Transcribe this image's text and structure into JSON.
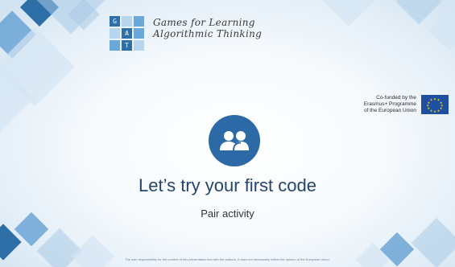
{
  "logo": {
    "title_line1": "Games for Learning",
    "title_line2": "Algorithmic Thinking",
    "tiles": [
      "G",
      "",
      "",
      "",
      "A",
      "",
      "",
      "T",
      ""
    ]
  },
  "eu": {
    "line1": "Co-funded by the",
    "line2": "Erasmus+ Programme",
    "line3": "of the European Union"
  },
  "main": {
    "title": "Let’s try your first code",
    "subtitle": "Pair activity"
  },
  "footer": {
    "disclaimer": "The sole responsibility for the content of this presentation lies with the authors. It does not necessarily reflect the opinion of the European Union."
  },
  "colors": {
    "accent": "#2b6aa6",
    "title_text": "#24456c",
    "eu_flag": "#1f4fa0",
    "eu_stars": "#ffdd00"
  },
  "icons": {
    "center": "people-icon",
    "eu": "eu-flag-icon"
  }
}
